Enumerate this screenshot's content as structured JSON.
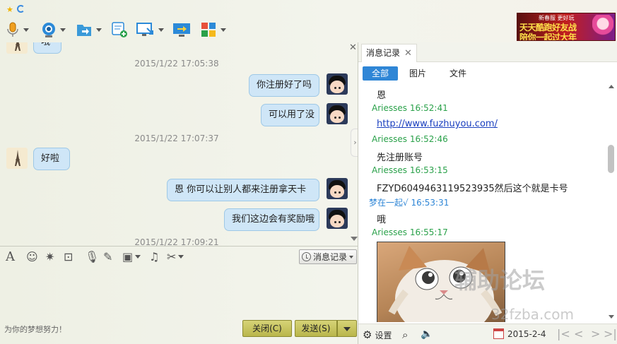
{
  "toolbar": {
    "icons": [
      "microphone-icon",
      "video-camera-icon",
      "send-file-icon",
      "chat-add-icon",
      "remote-desktop-icon",
      "screen-share-icon",
      "apps-grid-icon"
    ]
  },
  "banner": {
    "line1": "新春服 更好玩",
    "line2": "天天酷跑好友战",
    "line3": "陪你一起过大年"
  },
  "chat": {
    "messages": [
      {
        "type": "incoming",
        "text": "哦"
      },
      {
        "type": "time",
        "text": "2015/1/22 17:05:38"
      },
      {
        "type": "outgoing",
        "text": "你注册好了吗"
      },
      {
        "type": "outgoing",
        "text": "可以用了没"
      },
      {
        "type": "time",
        "text": "2015/1/22 17:07:37"
      },
      {
        "type": "incoming",
        "text": "好啦"
      },
      {
        "type": "outgoing",
        "text": "恩 你可以让别人都来注册拿天卡"
      },
      {
        "type": "outgoing",
        "text": "我们这边会有奖励哦"
      },
      {
        "type": "time",
        "text": "2015/1/22 17:09:21"
      }
    ]
  },
  "inputbar": {
    "icons": [
      "font-icon",
      "emoji-icon",
      "magic-icon",
      "screenshot-icon",
      "voice-message-icon",
      "edit-icon",
      "image-icon",
      "music-icon",
      "scissors-icon"
    ],
    "history_button": "消息记录"
  },
  "footer": {
    "motto": "为你的梦想努力！",
    "close_label": "关闭(C)",
    "send_label": "发送(S)"
  },
  "history": {
    "tab_label": "消息记录",
    "filters": [
      "全部",
      "图片",
      "文件"
    ],
    "entries": [
      {
        "kind": "msg",
        "text": "恩"
      },
      {
        "kind": "name",
        "self": false,
        "text": "Ariesses 16:52:41"
      },
      {
        "kind": "link",
        "text": "http://www.fuzhuyou.com/"
      },
      {
        "kind": "name",
        "self": false,
        "text": "Ariesses 16:52:46"
      },
      {
        "kind": "msg",
        "text": "先注册账号"
      },
      {
        "kind": "name",
        "self": false,
        "text": "Ariesses 16:53:15"
      },
      {
        "kind": "msg",
        "text": "FZYD6049463119523935然后这个就是卡号"
      },
      {
        "kind": "name",
        "self": true,
        "text": "梦在一起√ 16:53:31"
      },
      {
        "kind": "msg",
        "text": "哦"
      },
      {
        "kind": "name",
        "self": false,
        "text": "Ariesses 16:55:17"
      }
    ],
    "settings_label": "设置",
    "date": "2015-2-4"
  },
  "watermark": {
    "line1": "辅助论坛",
    "line2": "32fzba.com"
  },
  "colors": {
    "bubble": "#cfe6f7",
    "accent": "#2f86d6",
    "name_green": "#2aa14a",
    "button": "#c9c660"
  }
}
